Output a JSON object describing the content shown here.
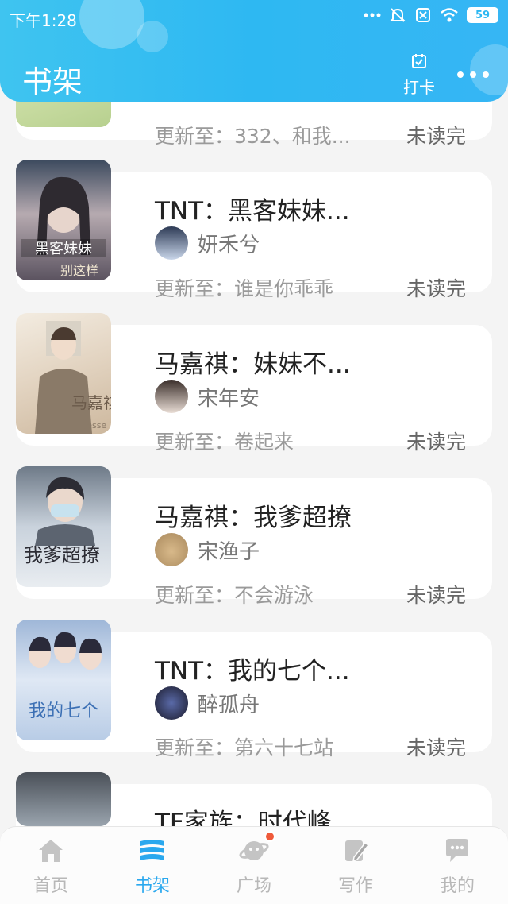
{
  "status_bar": {
    "time": "下午1:28",
    "battery": "59"
  },
  "header": {
    "title": "书架",
    "checkin_label": "打卡"
  },
  "books": [
    {
      "title": "",
      "author": "",
      "update": "更新至：332、和我...",
      "status": "未读完"
    },
    {
      "title": "TNT：黑客妹妹...",
      "author": "妍禾兮",
      "update": "更新至：谁是你乖乖",
      "status": "未读完"
    },
    {
      "title": "马嘉祺：妹妹不...",
      "author": "宋年安",
      "update": "更新至：卷起来",
      "status": "未读完"
    },
    {
      "title": "马嘉祺：我爹超撩",
      "author": "宋渔子",
      "update": "更新至：不会游泳",
      "status": "未读完"
    },
    {
      "title": "TNT：我的七个...",
      "author": "醉孤舟",
      "update": "更新至：第六十七站",
      "status": "未读完"
    },
    {
      "title": "TF家族：时代峰...",
      "author": "",
      "update": "",
      "status": ""
    }
  ],
  "nav": [
    {
      "label": "首页",
      "icon": "home-icon"
    },
    {
      "label": "书架",
      "icon": "bookshelf-icon"
    },
    {
      "label": "广场",
      "icon": "planet-icon"
    },
    {
      "label": "写作",
      "icon": "pen-icon"
    },
    {
      "label": "我的",
      "icon": "chat-bubble-icon"
    }
  ],
  "colors": {
    "accent": "#2eb8f2",
    "nav_active": "#2aa8ee",
    "badge": "#ef5a3a"
  }
}
